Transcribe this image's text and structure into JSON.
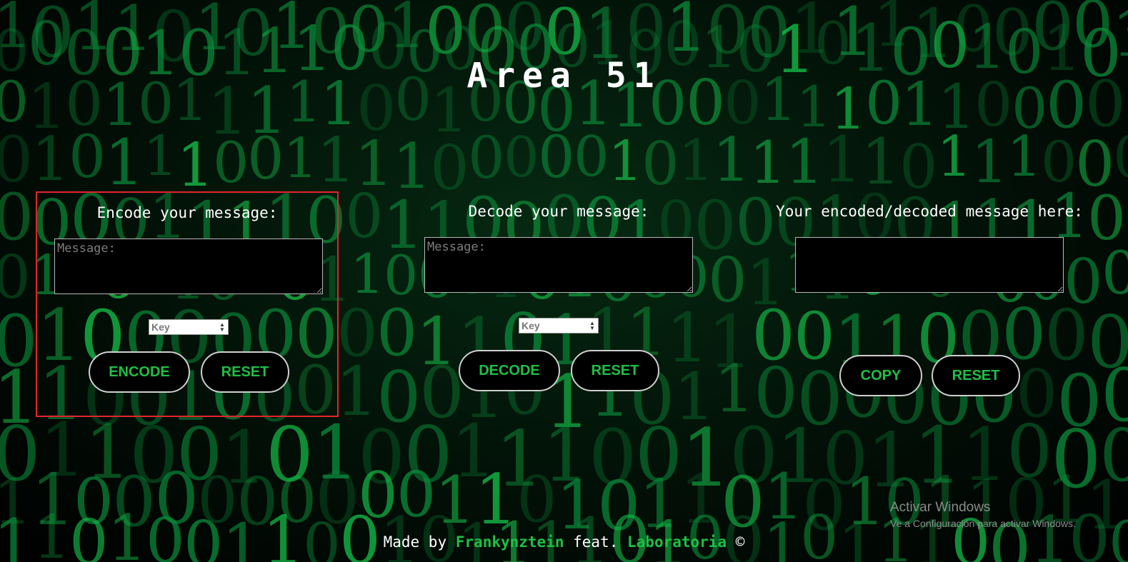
{
  "header": {
    "title": "Area 51"
  },
  "encode": {
    "heading": "Encode your message:",
    "placeholder": "Message:",
    "key_placeholder": "Key",
    "primary_label": "ENCODE",
    "reset_label": "RESET"
  },
  "decode": {
    "heading": "Decode your message:",
    "placeholder": "Message:",
    "key_placeholder": "Key",
    "primary_label": "DECODE",
    "reset_label": "RESET"
  },
  "output": {
    "heading": "Your encoded/decoded message here:",
    "copy_label": "COPY",
    "reset_label": "RESET"
  },
  "footer": {
    "made_by": "Made by",
    "author": "Frankynztein",
    "feat": "feat.",
    "partner": "Laboratoria",
    "copyright": "©"
  },
  "watermark": {
    "title": "Activar Windows",
    "subtitle": "Ve a Configuración para activar Windows."
  },
  "colors": {
    "accent": "#1fbf44",
    "highlight_border": "#e3242b",
    "background": "#000000"
  }
}
